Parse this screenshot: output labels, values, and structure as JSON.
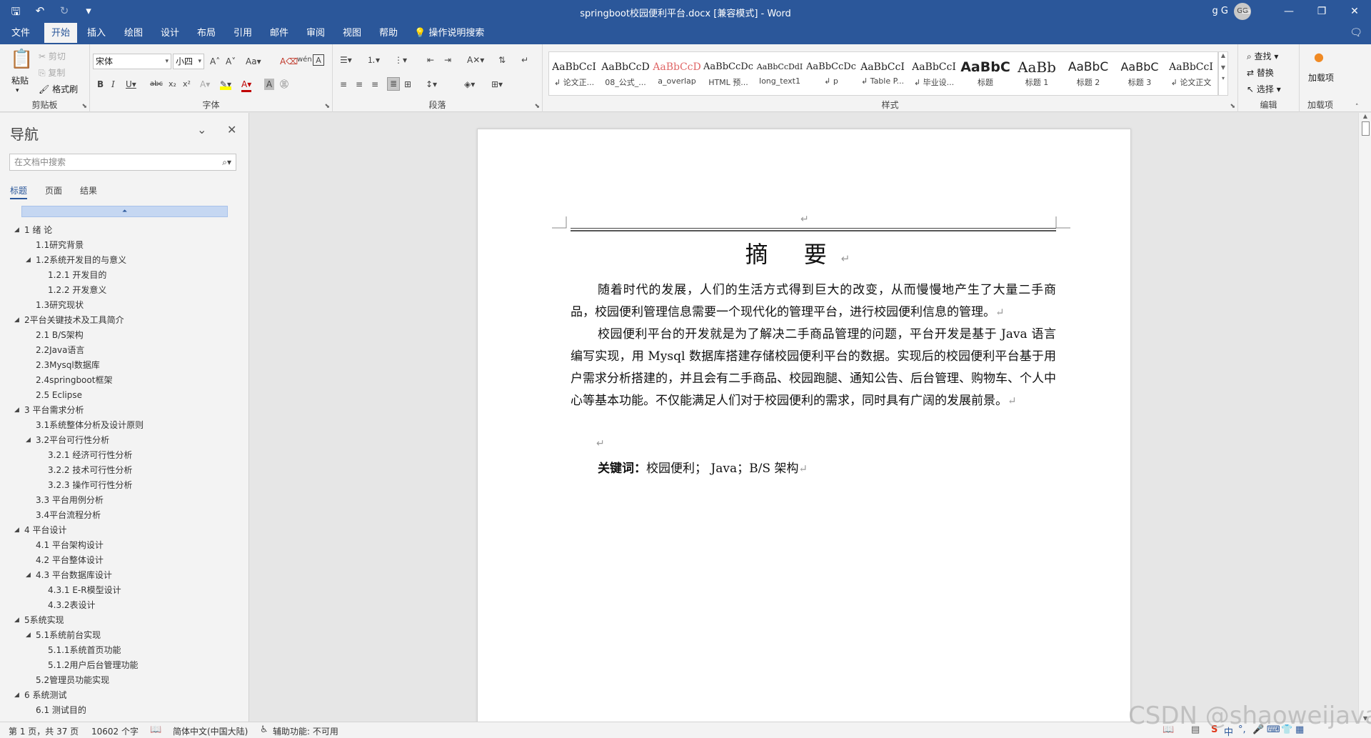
{
  "window": {
    "title": "springboot校园便利平台.docx [兼容模式]  -  Word",
    "user": "g G",
    "avatar_initials": "GG"
  },
  "ribbon_tabs": [
    "文件",
    "开始",
    "插入",
    "绘图",
    "设计",
    "布局",
    "引用",
    "邮件",
    "审阅",
    "视图",
    "帮助"
  ],
  "active_tab": "开始",
  "tell_me": "操作说明搜索",
  "clipboard": {
    "paste": "粘贴",
    "cut": "剪切",
    "copy": "复制",
    "format_painter": "格式刷",
    "label": "剪贴板"
  },
  "font": {
    "name": "宋体",
    "size": "小四",
    "label": "字体"
  },
  "paragraph": {
    "label": "段落"
  },
  "styles": {
    "label": "样式",
    "items": [
      {
        "preview": "AaBbCcI",
        "name": "↲ 论文正..."
      },
      {
        "preview": "AaBbCcD",
        "name": "08_公式_..."
      },
      {
        "preview": "AaBbCcD",
        "name": "a_overlap"
      },
      {
        "preview": "AaBbCcDc",
        "name": "HTML 预..."
      },
      {
        "preview": "AaBbCcDdI",
        "name": "long_text1"
      },
      {
        "preview": "AaBbCcDc",
        "name": "↲ p"
      },
      {
        "preview": "AaBbCcI",
        "name": "↲ Table P..."
      },
      {
        "preview": "AaBbCcI",
        "name": "↲ 毕业设..."
      },
      {
        "preview": "AaBbC",
        "name": "标题"
      },
      {
        "preview": "AaBb",
        "name": "标题 1"
      },
      {
        "preview": "AaBbC",
        "name": "标题 2"
      },
      {
        "preview": "AaBbC",
        "name": "标题 3"
      },
      {
        "preview": "AaBbCcI",
        "name": "↲ 论文正文"
      }
    ]
  },
  "editing": {
    "find": "查找",
    "replace": "替换",
    "select": "选择",
    "label": "编辑"
  },
  "addins": {
    "button": "加载项",
    "label": "加载项"
  },
  "nav": {
    "title": "导航",
    "search_placeholder": "在文档中搜索",
    "tabs": [
      "标题",
      "页面",
      "结果"
    ],
    "headings": [
      {
        "text": "1 绪  论",
        "level": 1,
        "expanded": true
      },
      {
        "text": "1.1研究背景",
        "level": 2,
        "expanded": false
      },
      {
        "text": "1.2系统开发目的与意义",
        "level": 2,
        "expanded": true
      },
      {
        "text": "1.2.1 开发目的",
        "level": 3,
        "expanded": false
      },
      {
        "text": "1.2.2 开发意义",
        "level": 3,
        "expanded": false
      },
      {
        "text": "1.3研究现状",
        "level": 2,
        "expanded": false
      },
      {
        "text": "2平台关键技术及工具简介",
        "level": 1,
        "expanded": true
      },
      {
        "text": "2.1 B/S架构",
        "level": 2,
        "expanded": false
      },
      {
        "text": "2.2Java语言",
        "level": 2,
        "expanded": false
      },
      {
        "text": "2.3Mysql数据库",
        "level": 2,
        "expanded": false
      },
      {
        "text": "2.4springboot框架",
        "level": 2,
        "expanded": false
      },
      {
        "text": "2.5 Eclipse",
        "level": 2,
        "expanded": false
      },
      {
        "text": "3 平台需求分析",
        "level": 1,
        "expanded": true
      },
      {
        "text": "3.1系统整体分析及设计原则",
        "level": 2,
        "expanded": false
      },
      {
        "text": "3.2平台可行性分析",
        "level": 2,
        "expanded": true
      },
      {
        "text": "3.2.1 经济可行性分析",
        "level": 3,
        "expanded": false
      },
      {
        "text": "3.2.2 技术可行性分析",
        "level": 3,
        "expanded": false
      },
      {
        "text": "3.2.3 操作可行性分析",
        "level": 3,
        "expanded": false
      },
      {
        "text": "3.3 平台用例分析",
        "level": 2,
        "expanded": false
      },
      {
        "text": "3.4平台流程分析",
        "level": 2,
        "expanded": false
      },
      {
        "text": "4 平台设计",
        "level": 1,
        "expanded": true
      },
      {
        "text": "4.1 平台架构设计",
        "level": 2,
        "expanded": false
      },
      {
        "text": "4.2 平台整体设计",
        "level": 2,
        "expanded": false
      },
      {
        "text": "4.3 平台数据库设计",
        "level": 2,
        "expanded": true
      },
      {
        "text": "4.3.1 E-R模型设计",
        "level": 3,
        "expanded": false
      },
      {
        "text": "4.3.2表设计",
        "level": 3,
        "expanded": false
      },
      {
        "text": "5系统实现",
        "level": 1,
        "expanded": true
      },
      {
        "text": "5.1系统前台实现",
        "level": 2,
        "expanded": true
      },
      {
        "text": "5.1.1系统首页功能",
        "level": 3,
        "expanded": false
      },
      {
        "text": "5.1.2用户后台管理功能",
        "level": 3,
        "expanded": false
      },
      {
        "text": "5.2管理员功能实现",
        "level": 2,
        "expanded": false
      },
      {
        "text": "6 系统测试",
        "level": 1,
        "expanded": true
      },
      {
        "text": "6.1 测试目的",
        "level": 2,
        "expanded": false
      }
    ]
  },
  "document": {
    "heading": "摘  要",
    "paragraphs": [
      "随着时代的发展，人们的生活方式得到巨大的改变，从而慢慢地产生了大量二手商品，校园便利管理信息需要一个现代化的管理平台，进行校园便利信息的管理。",
      "校园便利平台的开发就是为了解决二手商品管理的问题，平台开发是基于 Java 语言编写实现，用 Mysql 数据库搭建存储校园便利平台的数据。实现后的校园便利平台基于用户需求分析搭建的，并且会有二手商品、校园跑腿、通知公告、后台管理、购物车、个人中心等基本功能。不仅能满足人们对于校园便利的需求，同时具有广阔的发展前景。"
    ],
    "keywords_label": "关键词：",
    "keywords": "校园便利；  Java；B/S 架构"
  },
  "status_bar": {
    "page": "第 1 页，共 37 页",
    "words": "10602 个字",
    "language": "简体中文(中国大陆)",
    "accessibility": "辅助功能: 不可用"
  },
  "watermark": "CSDN @shaoweijava",
  "colors": {
    "accent": "#2b579a",
    "ribbon_bg": "#f3f3f3",
    "nav_selected": "#c5d7f2"
  }
}
